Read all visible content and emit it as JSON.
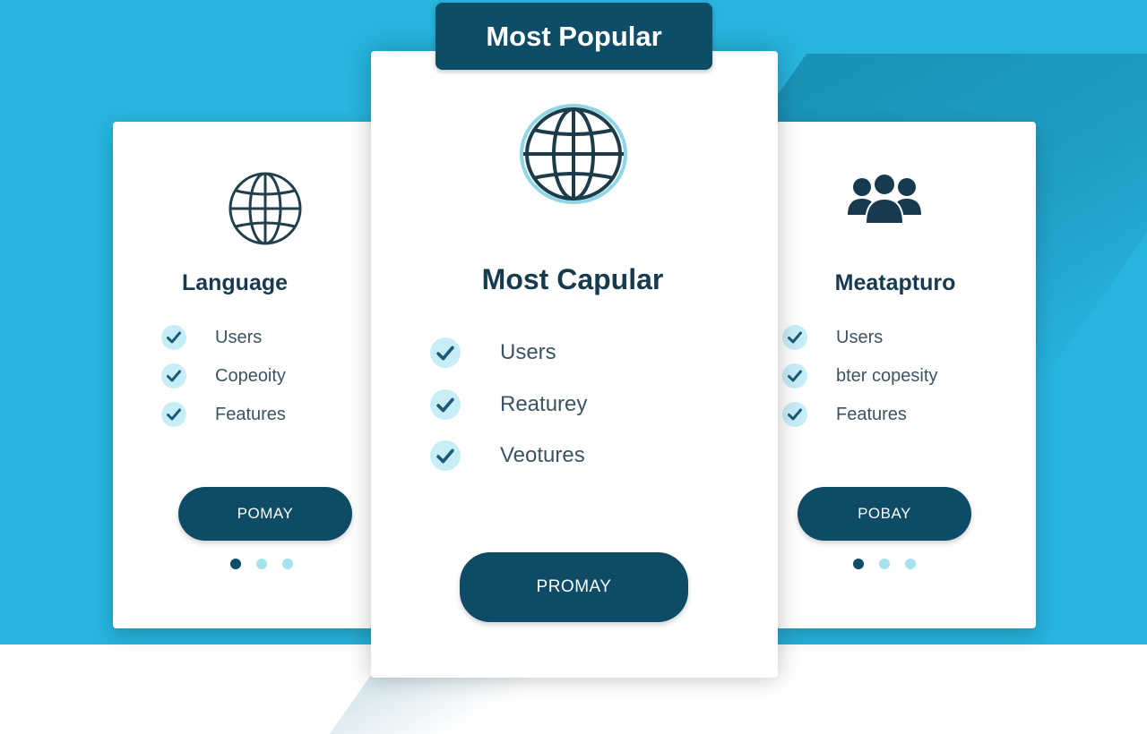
{
  "badge": {
    "label": "Most Popular"
  },
  "cards": {
    "left": {
      "title": "Language",
      "icon": "globe-icon",
      "features": [
        "Users",
        "Copeoity",
        "Features"
      ],
      "button_label": "POMAY"
    },
    "center": {
      "title": "Most Capular",
      "icon": "globe-icon",
      "features": [
        "Users",
        "Reaturey",
        "Veotures"
      ],
      "button_label": "PROMAY"
    },
    "right": {
      "title": "Meatapturo",
      "icon": "users-group-icon",
      "features": [
        "Users",
        "bter copesity",
        "Features"
      ],
      "button_label": "POBAY"
    }
  },
  "carousel": {
    "active_index": 0,
    "total": 3
  },
  "colors": {
    "background": "#27b4dd",
    "primary": "#0f4c67",
    "check_bg": "#c7eef7",
    "check_mark": "#1c5a78",
    "dot_inactive": "#a6e2ee"
  }
}
